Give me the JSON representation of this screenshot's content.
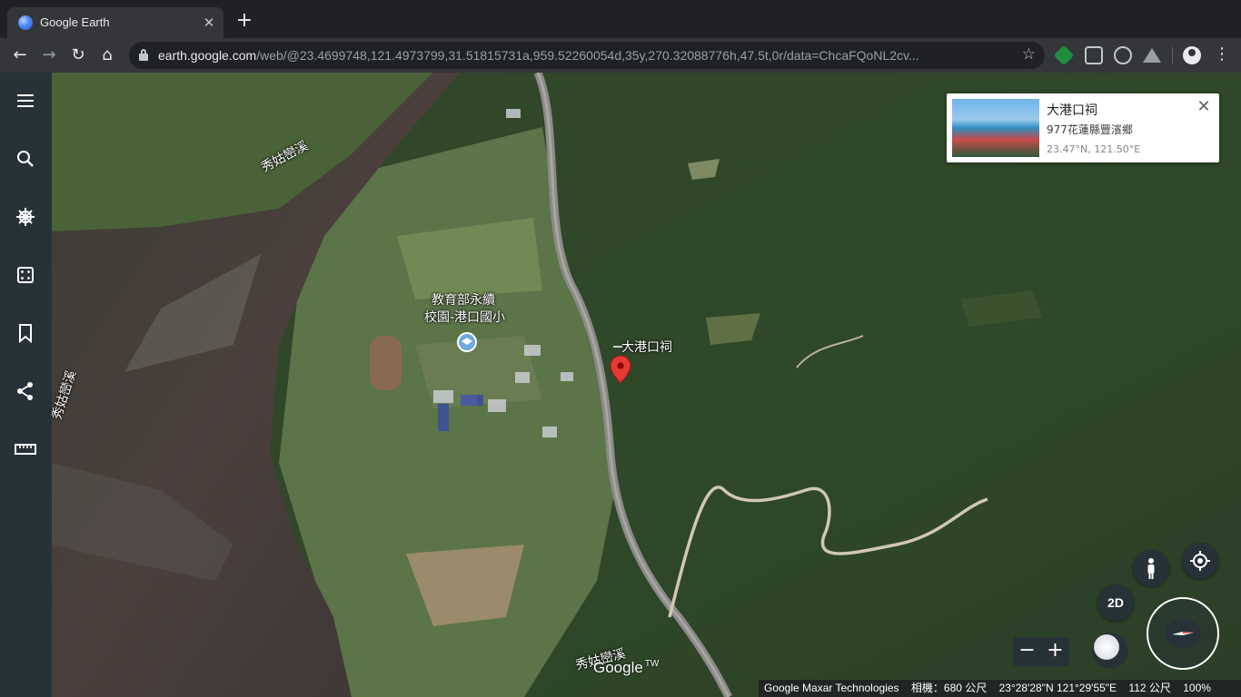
{
  "browser": {
    "tab_title": "Google Earth",
    "tab_close": "✕",
    "new_tab": "+",
    "url_host": "earth.google.com",
    "url_path": "/web/@23.4699748,121.4973799,31.51815731a,959.52260054d,35y,270.32088776h,47.5t,0r/data=ChcaFQoNL2cv...",
    "back_icon": "←",
    "forward_icon": "→",
    "reload_icon": "↻",
    "home_icon": "⌂",
    "star_icon": "☆",
    "menu_icon": "⋮"
  },
  "sidebar": {
    "items": [
      {
        "name": "menu-icon"
      },
      {
        "name": "search-icon"
      },
      {
        "name": "voyager-icon"
      },
      {
        "name": "feeling-lucky-icon"
      },
      {
        "name": "projects-icon"
      },
      {
        "name": "share-icon"
      },
      {
        "name": "measure-icon"
      }
    ]
  },
  "map": {
    "labels": {
      "river_top": "秀姑巒溪",
      "river_left": "秀姑巒溪",
      "river_bottom": "秀姑巒溪",
      "school_line1": "教育部永續",
      "school_line2": "校園-港口國小",
      "shrine": "大港口祠",
      "google": "Google",
      "tw": "TW"
    }
  },
  "card": {
    "title": "大港口祠",
    "subtitle": "977花蓮縣豐濱鄉",
    "coords": "23.47°N, 121.50°E",
    "close": "✕"
  },
  "controls": {
    "view_2d": "2D",
    "zoom_out": "−",
    "zoom_in": "+"
  },
  "attribution": {
    "source": "Google Maxar Technologies",
    "camera": "相機：680 公尺",
    "coords": "23°28'28\"N 121°29'55\"E",
    "elevation": "112 公尺",
    "zoom": "100%"
  },
  "colors": {
    "sidebar": "#263238",
    "marker": "#e53935",
    "river": "#4a3e3b",
    "forest": "#34482a"
  }
}
